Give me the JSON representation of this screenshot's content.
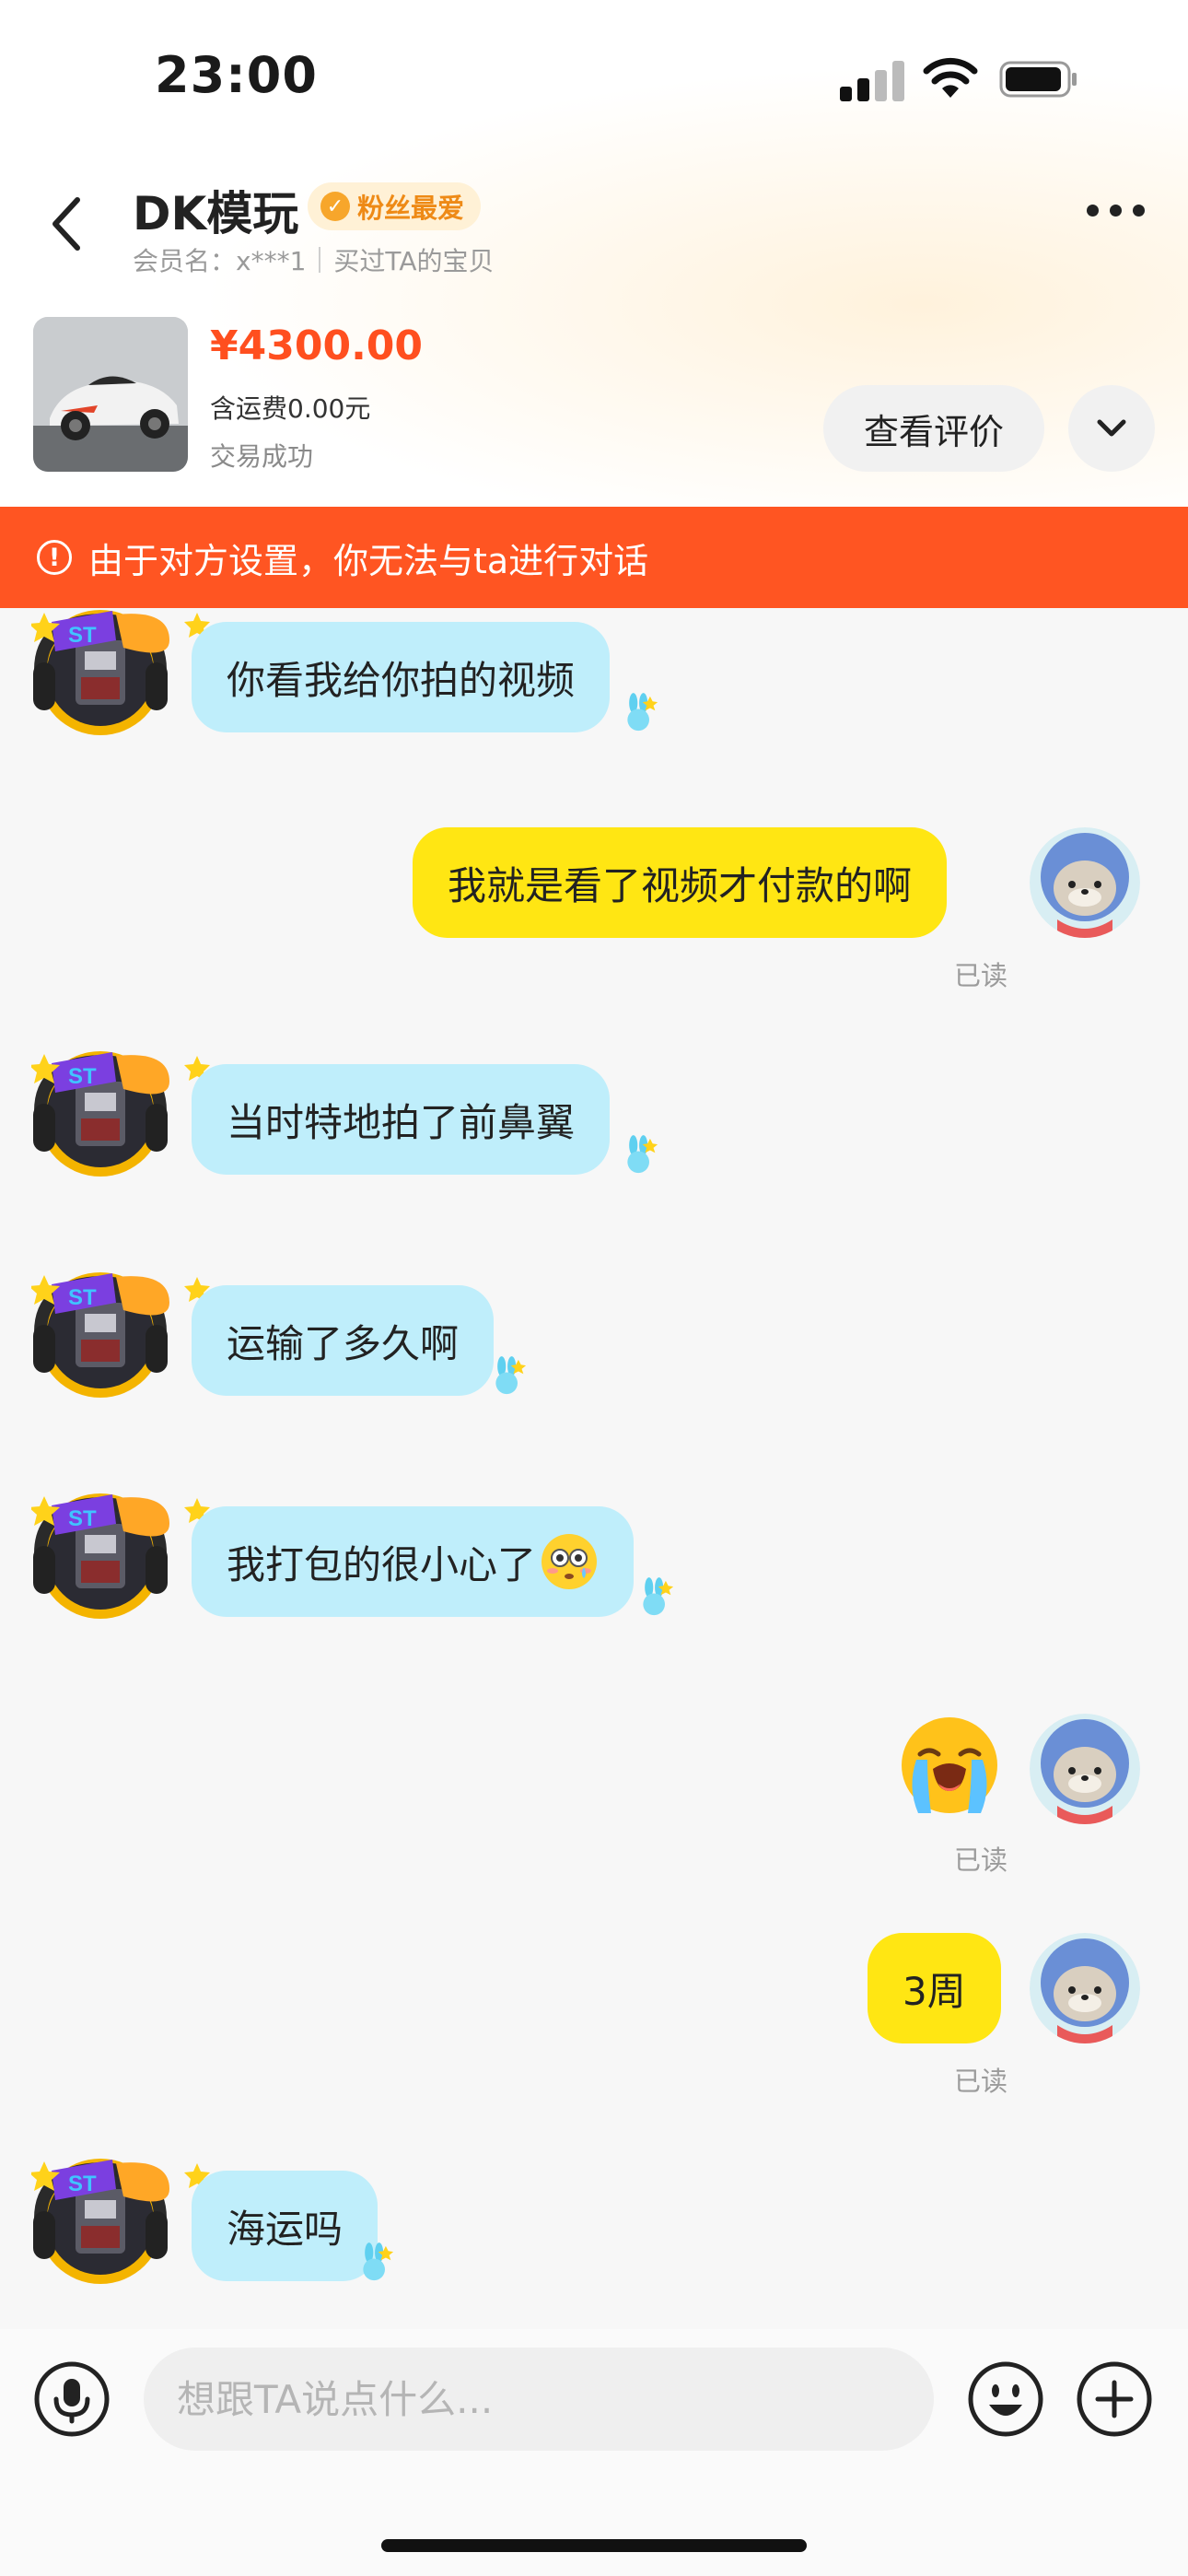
{
  "status_bar": {
    "time": "23:00"
  },
  "header": {
    "shop_name": "DK模玩",
    "badge": "粉丝最爱",
    "member_label": "会员名：x***1",
    "purchase_label": "买过TA的宝贝"
  },
  "product": {
    "price": "¥4300.00",
    "shipping": "含运费0.00元",
    "status": "交易成功",
    "review_button": "查看评价"
  },
  "banner": {
    "text": "由于对方设置，你无法与ta进行对话"
  },
  "messages": [
    {
      "from": "shop",
      "text": "你看我给你拍的视频"
    },
    {
      "from": "me",
      "text": "我就是看了视频才付款的啊",
      "status": "已读"
    },
    {
      "from": "shop",
      "text": "当时特地拍了前鼻翼"
    },
    {
      "from": "shop",
      "text": "运输了多久啊"
    },
    {
      "from": "shop",
      "text": "我打包的很小心了",
      "emoji": "flushed-face"
    },
    {
      "from": "me",
      "emoji": "loudly-crying-face",
      "status": "已读"
    },
    {
      "from": "me",
      "text": "3周",
      "status": "已读"
    },
    {
      "from": "shop",
      "text": "海运吗"
    }
  ],
  "input": {
    "placeholder": "想跟TA说点什么..."
  },
  "icons": {
    "back": "chevron-left-icon",
    "more": "more-dots-icon",
    "expand": "chevron-down-icon",
    "mic": "microphone-icon",
    "emoji": "smiley-icon",
    "plus": "plus-icon"
  },
  "colors": {
    "price": "#ff4f1f",
    "banner": "#ff5522",
    "bubble_in": "#bfeefb",
    "bubble_out": "#ffe613",
    "badge": "#ee8a16"
  }
}
